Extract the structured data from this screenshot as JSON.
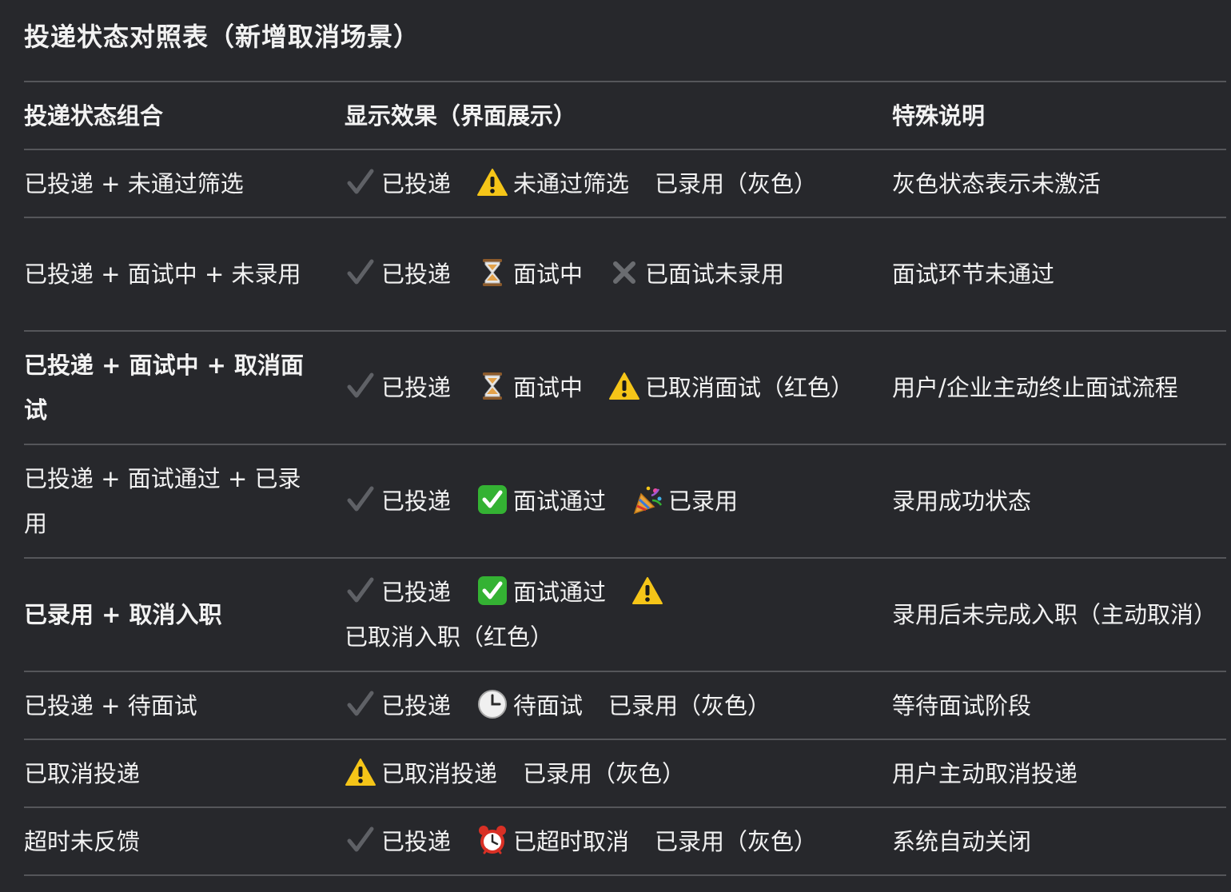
{
  "title": "投递状态对照表（新增取消场景）",
  "headers": [
    "投递状态组合",
    "显示效果（界面展示）",
    "特殊说明"
  ],
  "colors": {
    "background": "#27282c",
    "divider": "#55565a",
    "text": "#f2f2f2"
  },
  "rows": [
    {
      "combo": "已投递 + 未通过筛选",
      "chips": [
        {
          "icon": "check-mark-icon",
          "text": "已投递"
        },
        {
          "icon": "warning-icon",
          "text": "未通过筛选"
        }
      ],
      "status": "已录用（灰色）",
      "note": "灰色状态表示未激活"
    },
    {
      "combo": "已投递 + 面试中 + 未录用",
      "chips": [
        {
          "icon": "check-mark-icon",
          "text": "已投递"
        },
        {
          "icon": "hourglass-icon",
          "text": "面试中"
        },
        {
          "icon": "cross-mark-icon",
          "text": "已面试未录用"
        }
      ],
      "note": "面试环节未通过"
    },
    {
      "combo": "已投递 + 面试中 + 取消面试",
      "bold": true,
      "chips": [
        {
          "icon": "check-mark-icon",
          "text": "已投递"
        },
        {
          "icon": "hourglass-icon",
          "text": "面试中"
        }
      ],
      "status_icon": "warning-icon",
      "status": "已取消面试（红色）",
      "note": "用户/企业主动终止面试流程"
    },
    {
      "combo": "已投递 + 面试通过 + 已录用",
      "chips": [
        {
          "icon": "check-mark-icon",
          "text": "已投递"
        },
        {
          "icon": "green-check-icon",
          "text": "面试通过"
        },
        {
          "icon": "party-popper-icon",
          "text": "已录用"
        }
      ],
      "note": "录用成功状态"
    },
    {
      "combo": "已录用 + 取消入职",
      "bold": true,
      "chips": [
        {
          "icon": "check-mark-icon",
          "text": "已投递"
        },
        {
          "icon": "green-check-icon",
          "text": "面试通过"
        }
      ],
      "status_icon": "warning-icon",
      "status": "已取消入职（红色）",
      "note": "录用后未完成入职（主动取消）"
    },
    {
      "combo": "已投递 + 待面试",
      "chips": [
        {
          "icon": "check-mark-icon",
          "text": "已投递"
        },
        {
          "icon": "clock-icon",
          "text": "待面试"
        }
      ],
      "status": "已录用（灰色）",
      "note": "等待面试阶段"
    },
    {
      "combo": "已取消投递",
      "chips": [
        {
          "icon": "warning-icon",
          "text": "已取消投递"
        }
      ],
      "status": "已录用（灰色）",
      "note": "用户主动取消投递"
    },
    {
      "combo": "超时未反馈",
      "chips": [
        {
          "icon": "check-mark-icon",
          "text": "已投递"
        },
        {
          "icon": "alarm-clock-icon",
          "text": "已超时取消"
        }
      ],
      "status": "已录用（灰色）",
      "note": "系统自动关闭"
    }
  ]
}
